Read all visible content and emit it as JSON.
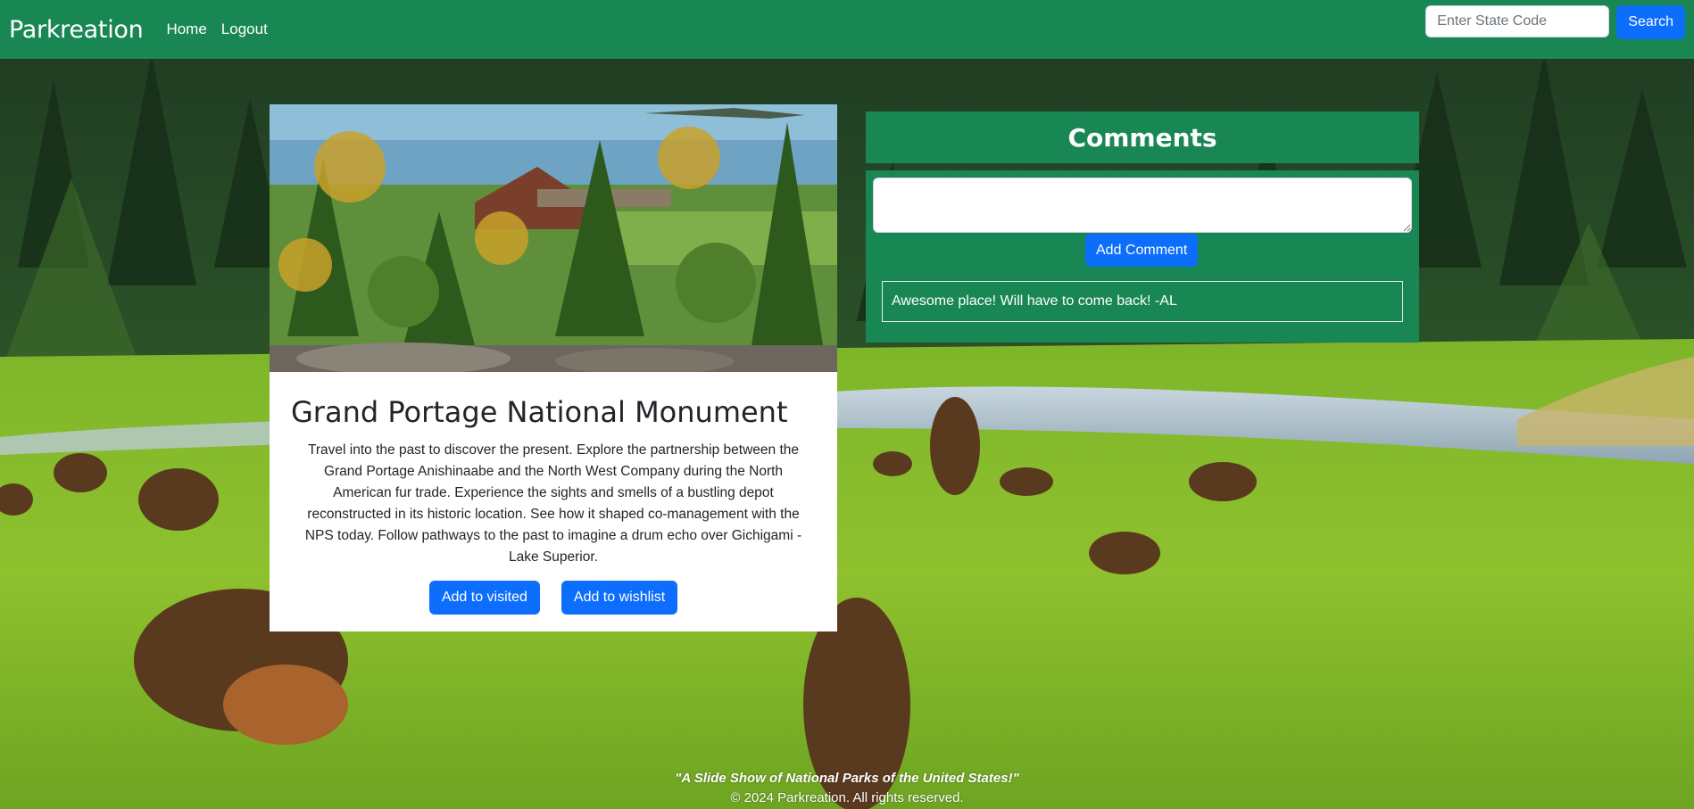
{
  "nav": {
    "brand": "Parkreation",
    "links": [
      "Home",
      "Logout"
    ],
    "search_placeholder": "Enter State Code",
    "search_value": "",
    "search_button": "Search"
  },
  "park": {
    "name": "Grand Portage National Monument",
    "description": "Travel into the past to discover the present. Explore the partnership between the Grand Portage Anishinaabe and the North West Company during the North American fur trade. Experience the sights and smells of a bustling depot reconstructed in its historic location. See how it shaped co-management with the NPS today. Follow pathways to the past to imagine a drum echo over Gichigami - Lake Superior.",
    "buttons": {
      "visited": "Add to visited",
      "wishlist": "Add to wishlist"
    }
  },
  "comments": {
    "title": "Comments",
    "textarea_value": "",
    "add_button": "Add Comment",
    "items": [
      "Awesome place! Will have to come back! -AL"
    ]
  },
  "footer": {
    "tagline": "\"A Slide Show of National Parks of the United States!\"",
    "copyright": "© 2024 Parkreation. All rights reserved."
  },
  "colors": {
    "navbar": "#198754",
    "primary_button": "#0d6efd",
    "comments_panel": "#198754",
    "card_background": "#ffffff"
  }
}
